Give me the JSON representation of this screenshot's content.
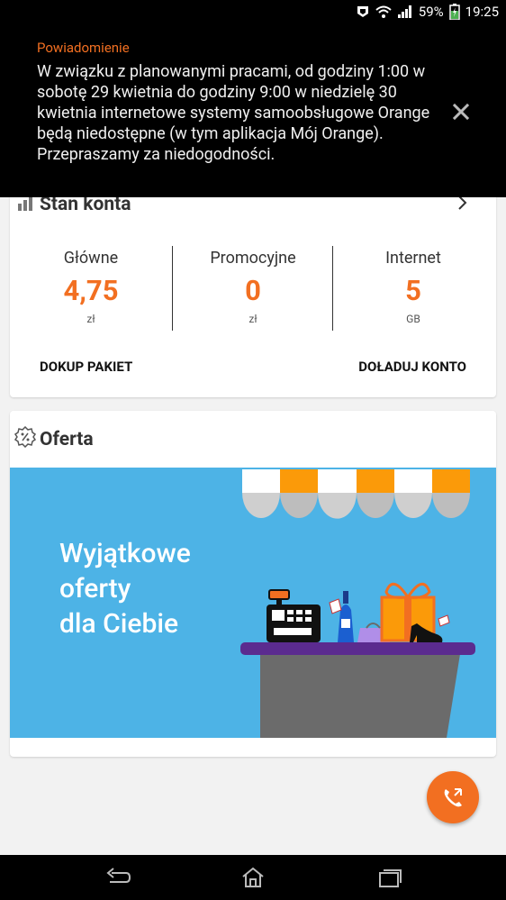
{
  "status_bar": {
    "battery": "59%",
    "time": "19:25"
  },
  "notification": {
    "title": "Powiadomienie",
    "body": "W związku z planowanymi pracami, od godziny 1:00 w sobotę 29 kwietnia do godziny 9:00 w niedzielę 30 kwietnia internetowe systemy samoobsługowe Orange będą niedostępne (w tym aplikacja Mój Orange). Przepraszamy za niedogodności."
  },
  "account": {
    "title": "Stan konta",
    "columns": [
      {
        "label": "Główne",
        "value": "4,75",
        "unit": "zł"
      },
      {
        "label": "Promocyjne",
        "value": "0",
        "unit": "zł"
      },
      {
        "label": "Internet",
        "value": "5",
        "unit": "GB"
      }
    ],
    "actions": {
      "left": "DOKUP PAKIET",
      "right": "DOŁADUJ KONTO"
    }
  },
  "offer": {
    "title": "Oferta",
    "banner_lines": [
      "Wyjątkowe",
      "oferty",
      "dla Ciebie"
    ]
  },
  "colors": {
    "accent": "#f26f21",
    "banner": "#4db3e6"
  },
  "icons": [
    "notifications-icon",
    "wifi-icon",
    "signal-icon",
    "battery-icon",
    "close-icon",
    "bar-chart-icon",
    "chevron-right-icon",
    "percent-badge-icon",
    "phone-call-icon",
    "back-icon",
    "home-icon",
    "recents-icon"
  ]
}
